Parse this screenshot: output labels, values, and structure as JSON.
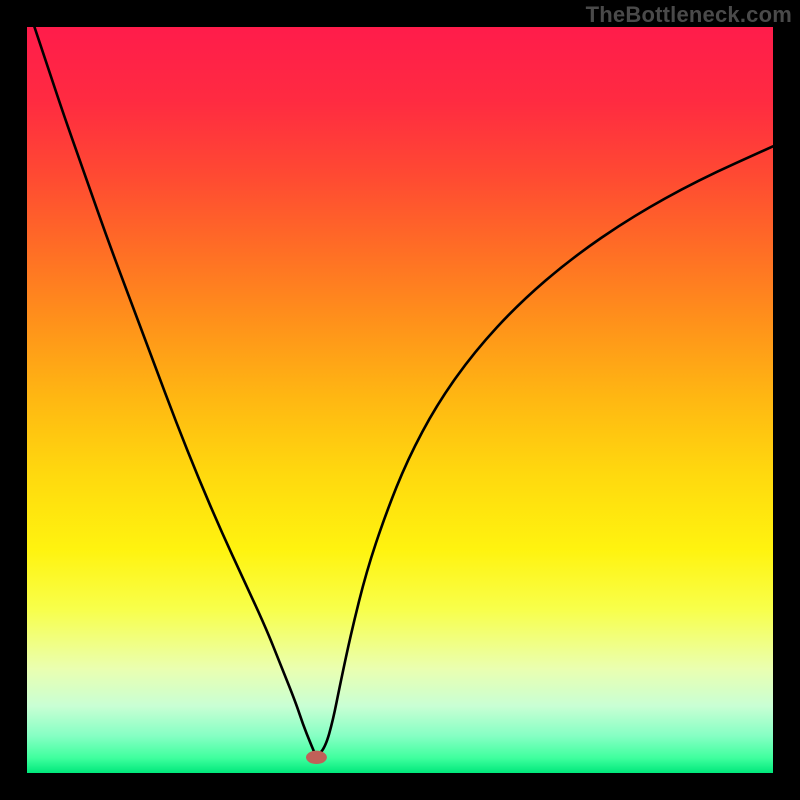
{
  "watermark": "TheBottleneck.com",
  "chart_data": {
    "type": "line",
    "title": "",
    "xlabel": "",
    "ylabel": "",
    "xlim": [
      0,
      100
    ],
    "ylim": [
      0,
      100
    ],
    "background_gradient": {
      "stops": [
        {
          "pos": 0.0,
          "color": "#ff1c4b"
        },
        {
          "pos": 0.1,
          "color": "#ff2b41"
        },
        {
          "pos": 0.2,
          "color": "#ff4a32"
        },
        {
          "pos": 0.3,
          "color": "#ff6e25"
        },
        {
          "pos": 0.4,
          "color": "#ff931a"
        },
        {
          "pos": 0.5,
          "color": "#ffb812"
        },
        {
          "pos": 0.6,
          "color": "#ffd90e"
        },
        {
          "pos": 0.7,
          "color": "#fff30f"
        },
        {
          "pos": 0.78,
          "color": "#f8ff4a"
        },
        {
          "pos": 0.86,
          "color": "#eaffb0"
        },
        {
          "pos": 0.91,
          "color": "#c9ffd4"
        },
        {
          "pos": 0.95,
          "color": "#86ffc4"
        },
        {
          "pos": 0.98,
          "color": "#3fff9e"
        },
        {
          "pos": 1.0,
          "color": "#00e87b"
        }
      ]
    },
    "series": [
      {
        "name": "bottleneck-curve",
        "color": "#000000",
        "x": [
          1,
          3,
          5,
          8,
          11,
          14,
          17,
          20,
          23,
          26,
          29,
          32,
          34,
          36,
          37,
          38,
          38.8,
          40,
          41,
          42,
          43.5,
          45.5,
          48,
          51,
          55,
          60,
          66,
          73,
          81,
          90,
          100
        ],
        "y": [
          100,
          94,
          88,
          79.5,
          71,
          63,
          55,
          47,
          39.5,
          32.5,
          26,
          19.5,
          14.5,
          9.5,
          6.5,
          4,
          2.1,
          3.5,
          7,
          12,
          19,
          27,
          34.5,
          42,
          49.5,
          56.5,
          63,
          69,
          74.5,
          79.5,
          84
        ]
      }
    ],
    "marker": {
      "name": "optimal-point",
      "x": 38.8,
      "y": 2.1,
      "rx": 1.4,
      "ry": 0.9,
      "fill": "#c06058"
    }
  }
}
